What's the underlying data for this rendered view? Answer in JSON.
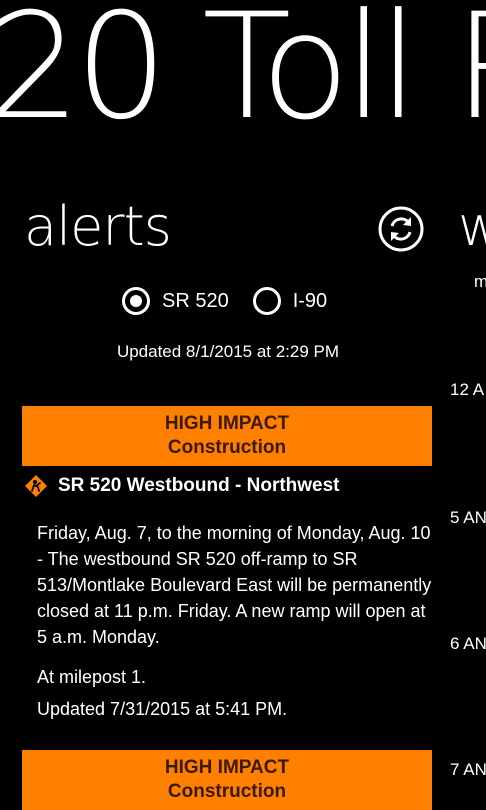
{
  "app": {
    "title": "20 Toll R"
  },
  "pivot": {
    "current": "alerts",
    "next": "w",
    "next_sub": "m"
  },
  "toolbar": {
    "refresh_icon": "refresh-icon"
  },
  "route_filter": {
    "options": [
      {
        "label": "SR 520",
        "selected": true
      },
      {
        "label": "I-90",
        "selected": false
      }
    ]
  },
  "updated": "Updated 8/1/2015 at 2:29 PM",
  "side_times": [
    "12 A",
    "5 AN",
    "6 AN",
    "7 AN"
  ],
  "alerts": [
    {
      "impact": "HIGH IMPACT",
      "category": "Construction",
      "heading": "SR 520 Westbound - Northwest",
      "body": "Friday, Aug. 7, to the morning of Monday, Aug. 10 - The westbound SR 520 off-ramp to SR 513/Montlake Boulevard East will be permanently closed at 11 p.m. Friday. A new ramp will open at 5 a.m. Monday.",
      "milepost": "At milepost 1.",
      "updated": "Updated 7/31/2015 at 5:41 PM."
    },
    {
      "impact": "HIGH IMPACT",
      "category": "Construction"
    }
  ],
  "colors": {
    "accent": "#FF7F00",
    "background": "#000000",
    "text": "#FFFFFF"
  }
}
